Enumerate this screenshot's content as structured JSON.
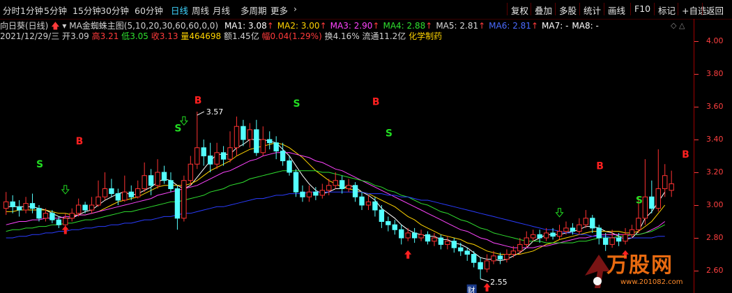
{
  "toolbar": {
    "periods": [
      "分时",
      "1分钟",
      "5分钟",
      "15分钟",
      "30分钟",
      "60分钟",
      "日线",
      "周线",
      "月线",
      "多周期",
      "更多"
    ],
    "active_period": "日线",
    "more_arrow": "›",
    "tools": [
      "复权",
      "叠加",
      "多股",
      "统计",
      "画线",
      "F10",
      "标记",
      "+自选",
      "返回"
    ]
  },
  "info": {
    "stock_name": "向日葵(日线)",
    "indicator": "MA金蜘蛛主图(5,10,20,30,60,60,0,0)",
    "ma": [
      {
        "label": "MA1: 3.08",
        "color": "#ffffff",
        "arrow": "↑"
      },
      {
        "label": "MA2: 3.00",
        "color": "#ffd400",
        "arrow": "↑"
      },
      {
        "label": "MA3: 2.90",
        "color": "#ff44ff",
        "arrow": "↑"
      },
      {
        "label": "MA4: 2.88",
        "color": "#2fe02f",
        "arrow": "↑"
      },
      {
        "label": "MA5: 2.81",
        "color": "#d8d8d8",
        "arrow": "↑"
      },
      {
        "label": "MA6: 2.81",
        "color": "#4a6bff",
        "arrow": "↑"
      },
      {
        "label": "MA7: -",
        "color": "#ffffff",
        "arrow": ""
      },
      {
        "label": "MA8: -",
        "color": "#ffffff",
        "arrow": ""
      }
    ],
    "date": "2021/12/29/三",
    "open_label": "开",
    "open": "3.09",
    "high_label": "高",
    "high": "3.21",
    "low_label": "低",
    "low": "3.05",
    "close_label": "收",
    "close": "3.13",
    "vol_label": "量",
    "vol": "464698",
    "amount_label": "额",
    "amount": "1.45亿",
    "range_label": "幅",
    "range": "0.04(1.29%)",
    "turnover_label": "换",
    "turnover": "4.16%",
    "float_label": "流通",
    "float": "11.2亿",
    "sector": "化学制药"
  },
  "colors": {
    "up": "#ff3232",
    "down": "#54ffff",
    "ma1": "#ffffff",
    "ma2": "#ffd400",
    "ma3": "#ff44ff",
    "ma4": "#2fe02f",
    "ma6": "#2a3cff",
    "axis": "#ff4040"
  },
  "chart_data": {
    "type": "candlestick",
    "ylim": [
      2.53,
      4.16
    ],
    "yticks": [
      "4.00",
      "3.80",
      "3.60",
      "3.40",
      "3.20",
      "3.00",
      "2.80",
      "2.60"
    ],
    "ytick_values": [
      4.0,
      3.8,
      3.6,
      3.4,
      3.2,
      3.0,
      2.8,
      2.6
    ],
    "candles": [
      [
        2.98,
        3.02,
        3.08,
        2.94
      ],
      [
        3.02,
        2.99,
        3.06,
        2.95
      ],
      [
        2.99,
        2.97,
        3.03,
        2.93
      ],
      [
        2.97,
        3.01,
        3.05,
        2.95
      ],
      [
        3.01,
        2.98,
        3.07,
        2.95
      ],
      [
        2.98,
        2.92,
        3.0,
        2.9
      ],
      [
        2.92,
        2.95,
        2.98,
        2.9
      ],
      [
        2.95,
        2.91,
        2.97,
        2.89
      ],
      [
        2.91,
        2.88,
        2.93,
        2.86
      ],
      [
        2.88,
        2.92,
        2.95,
        2.86
      ],
      [
        2.92,
        2.95,
        2.98,
        2.9
      ],
      [
        2.95,
        3.0,
        3.04,
        2.93
      ],
      [
        3.0,
        2.97,
        3.02,
        2.95
      ],
      [
        2.97,
        3.0,
        3.05,
        2.95
      ],
      [
        3.0,
        3.05,
        3.15,
        2.99
      ],
      [
        3.05,
        3.1,
        3.2,
        3.03
      ],
      [
        3.1,
        3.07,
        3.16,
        3.05
      ],
      [
        3.07,
        3.03,
        3.1,
        3.0
      ],
      [
        3.03,
        3.08,
        3.18,
        3.02
      ],
      [
        3.08,
        3.05,
        3.12,
        3.03
      ],
      [
        3.05,
        3.1,
        3.15,
        3.04
      ],
      [
        3.1,
        3.18,
        3.26,
        3.08
      ],
      [
        3.18,
        3.12,
        3.22,
        3.06
      ],
      [
        3.12,
        3.2,
        3.28,
        3.1
      ],
      [
        3.2,
        3.15,
        3.24,
        3.13
      ],
      [
        3.15,
        3.1,
        3.2,
        3.08
      ],
      [
        3.1,
        2.92,
        3.12,
        2.85
      ],
      [
        2.92,
        3.15,
        3.18,
        2.9
      ],
      [
        3.15,
        3.25,
        3.3,
        3.12
      ],
      [
        3.25,
        3.35,
        3.57,
        3.22
      ],
      [
        3.35,
        3.3,
        3.4,
        3.24
      ],
      [
        3.3,
        3.25,
        3.38,
        3.2
      ],
      [
        3.25,
        3.32,
        3.38,
        3.22
      ],
      [
        3.32,
        3.28,
        3.36,
        3.24
      ],
      [
        3.28,
        3.35,
        3.45,
        3.26
      ],
      [
        3.35,
        3.48,
        3.54,
        3.3
      ],
      [
        3.48,
        3.4,
        3.52,
        3.36
      ],
      [
        3.4,
        3.46,
        3.5,
        3.35
      ],
      [
        3.46,
        3.32,
        3.52,
        3.3
      ],
      [
        3.32,
        3.4,
        3.48,
        3.3
      ],
      [
        3.4,
        3.38,
        3.45,
        3.34
      ],
      [
        3.38,
        3.33,
        3.42,
        3.28
      ],
      [
        3.33,
        3.27,
        3.38,
        3.24
      ],
      [
        3.27,
        3.2,
        3.3,
        3.18
      ],
      [
        3.2,
        3.08,
        3.22,
        3.05
      ],
      [
        3.08,
        3.05,
        3.12,
        3.02
      ],
      [
        3.05,
        3.08,
        3.12,
        3.02
      ],
      [
        3.08,
        3.06,
        3.11,
        3.03
      ],
      [
        3.06,
        3.09,
        3.13,
        3.04
      ],
      [
        3.09,
        3.12,
        3.16,
        3.06
      ],
      [
        3.12,
        3.15,
        3.2,
        3.1
      ],
      [
        3.15,
        3.1,
        3.18,
        3.07
      ],
      [
        3.1,
        3.12,
        3.16,
        3.08
      ],
      [
        3.12,
        3.05,
        3.14,
        3.02
      ],
      [
        3.05,
        3.0,
        3.08,
        2.97
      ],
      [
        3.0,
        3.02,
        3.06,
        2.97
      ],
      [
        3.02,
        2.97,
        3.05,
        2.93
      ],
      [
        2.97,
        2.9,
        3.0,
        2.86
      ],
      [
        2.9,
        2.88,
        2.93,
        2.84
      ],
      [
        2.88,
        2.85,
        2.91,
        2.82
      ],
      [
        2.85,
        2.8,
        2.88,
        2.76
      ],
      [
        2.8,
        2.83,
        2.86,
        2.78
      ],
      [
        2.83,
        2.8,
        2.86,
        2.77
      ],
      [
        2.8,
        2.82,
        2.85,
        2.78
      ],
      [
        2.82,
        2.78,
        2.84,
        2.76
      ],
      [
        2.78,
        2.8,
        2.83,
        2.75
      ],
      [
        2.8,
        2.76,
        2.82,
        2.73
      ],
      [
        2.76,
        2.78,
        2.81,
        2.73
      ],
      [
        2.78,
        2.74,
        2.8,
        2.71
      ],
      [
        2.74,
        2.72,
        2.77,
        2.69
      ],
      [
        2.72,
        2.7,
        2.74,
        2.66
      ],
      [
        2.7,
        2.65,
        2.72,
        2.62
      ],
      [
        2.65,
        2.61,
        2.68,
        2.55
      ],
      [
        2.61,
        2.66,
        2.7,
        2.59
      ],
      [
        2.66,
        2.69,
        2.72,
        2.64
      ],
      [
        2.69,
        2.67,
        2.71,
        2.64
      ],
      [
        2.67,
        2.7,
        2.73,
        2.65
      ],
      [
        2.7,
        2.72,
        2.75,
        2.68
      ],
      [
        2.72,
        2.76,
        2.8,
        2.7
      ],
      [
        2.76,
        2.8,
        2.84,
        2.74
      ],
      [
        2.8,
        2.82,
        2.85,
        2.78
      ],
      [
        2.82,
        2.8,
        2.85,
        2.77
      ],
      [
        2.8,
        2.83,
        2.86,
        2.78
      ],
      [
        2.83,
        2.81,
        2.86,
        2.79
      ],
      [
        2.81,
        2.84,
        2.88,
        2.79
      ],
      [
        2.84,
        2.86,
        2.9,
        2.82
      ],
      [
        2.86,
        2.84,
        2.89,
        2.82
      ],
      [
        2.84,
        2.88,
        2.92,
        2.82
      ],
      [
        2.88,
        2.92,
        2.97,
        2.86
      ],
      [
        2.92,
        2.86,
        2.94,
        2.83
      ],
      [
        2.86,
        2.8,
        2.88,
        2.76
      ],
      [
        2.8,
        2.76,
        2.83,
        2.72
      ],
      [
        2.76,
        2.8,
        2.85,
        2.74
      ],
      [
        2.8,
        2.78,
        2.83,
        2.75
      ],
      [
        2.78,
        2.82,
        2.86,
        2.76
      ],
      [
        2.82,
        2.85,
        2.88,
        2.8
      ],
      [
        2.85,
        2.92,
        3.05,
        2.83
      ],
      [
        2.92,
        3.05,
        3.28,
        2.88
      ],
      [
        3.05,
        2.98,
        3.15,
        2.95
      ],
      [
        2.98,
        3.1,
        3.34,
        2.96
      ],
      [
        3.1,
        3.18,
        3.25,
        3.05
      ],
      [
        3.09,
        3.13,
        3.21,
        3.05
      ]
    ],
    "ma_lines": [
      {
        "name": "MA1",
        "color": "#ffffff",
        "values": [
          2.99,
          2.99,
          2.99,
          2.99,
          2.99,
          2.98,
          2.97,
          2.95,
          2.93,
          2.92,
          2.92,
          2.94,
          2.96,
          2.97,
          3.0,
          3.03,
          3.05,
          3.07,
          3.08,
          3.06,
          3.07,
          3.09,
          3.11,
          3.14,
          3.16,
          3.15,
          3.12,
          3.1,
          3.12,
          3.17,
          3.22,
          3.27,
          3.31,
          3.31,
          3.31,
          3.35,
          3.37,
          3.4,
          3.4,
          3.4,
          3.39,
          3.38,
          3.34,
          3.3,
          3.24,
          3.18,
          3.13,
          3.09,
          3.07,
          3.08,
          3.1,
          3.1,
          3.12,
          3.11,
          3.08,
          3.06,
          3.03,
          2.98,
          2.95,
          2.92,
          2.88,
          2.85,
          2.83,
          2.82,
          2.81,
          2.81,
          2.79,
          2.79,
          2.77,
          2.76,
          2.74,
          2.71,
          2.68,
          2.67,
          2.67,
          2.66,
          2.67,
          2.69,
          2.71,
          2.74,
          2.78,
          2.8,
          2.82,
          2.82,
          2.82,
          2.83,
          2.84,
          2.85,
          2.87,
          2.87,
          2.86,
          2.84,
          2.83,
          2.81,
          2.79,
          2.8,
          2.84,
          2.92,
          2.96,
          3.02,
          3.08
        ]
      },
      {
        "name": "MA2",
        "color": "#ffd400",
        "values": [
          2.96,
          2.96,
          2.97,
          2.97,
          2.97,
          2.97,
          2.97,
          2.96,
          2.95,
          2.95,
          2.94,
          2.94,
          2.94,
          2.95,
          2.96,
          2.98,
          3.0,
          3.02,
          3.03,
          3.04,
          3.05,
          3.07,
          3.09,
          3.11,
          3.12,
          3.12,
          3.12,
          3.12,
          3.13,
          3.15,
          3.18,
          3.21,
          3.23,
          3.25,
          3.27,
          3.3,
          3.32,
          3.34,
          3.35,
          3.36,
          3.37,
          3.38,
          3.37,
          3.35,
          3.32,
          3.29,
          3.25,
          3.21,
          3.18,
          3.15,
          3.13,
          3.11,
          3.1,
          3.09,
          3.08,
          3.07,
          3.05,
          3.03,
          3.01,
          2.99,
          2.96,
          2.93,
          2.91,
          2.88,
          2.86,
          2.84,
          2.82,
          2.81,
          2.8,
          2.79,
          2.77,
          2.76,
          2.74,
          2.72,
          2.71,
          2.7,
          2.7,
          2.7,
          2.7,
          2.71,
          2.72,
          2.74,
          2.76,
          2.77,
          2.79,
          2.8,
          2.81,
          2.82,
          2.83,
          2.84,
          2.84,
          2.84,
          2.84,
          2.84,
          2.83,
          2.83,
          2.84,
          2.87,
          2.9,
          2.95,
          3.0
        ]
      },
      {
        "name": "MA3",
        "color": "#ff44ff",
        "values": [
          2.88,
          2.89,
          2.9,
          2.9,
          2.91,
          2.91,
          2.92,
          2.92,
          2.92,
          2.93,
          2.93,
          2.94,
          2.94,
          2.95,
          2.96,
          2.97,
          2.98,
          2.99,
          3.0,
          3.01,
          3.02,
          3.03,
          3.04,
          3.06,
          3.07,
          3.08,
          3.09,
          3.1,
          3.11,
          3.12,
          3.14,
          3.16,
          3.18,
          3.2,
          3.21,
          3.23,
          3.25,
          3.27,
          3.28,
          3.3,
          3.31,
          3.32,
          3.32,
          3.32,
          3.31,
          3.3,
          3.29,
          3.27,
          3.26,
          3.24,
          3.22,
          3.21,
          3.19,
          3.17,
          3.15,
          3.13,
          3.11,
          3.09,
          3.07,
          3.05,
          3.03,
          3.01,
          2.99,
          2.97,
          2.95,
          2.93,
          2.91,
          2.89,
          2.87,
          2.85,
          2.84,
          2.82,
          2.8,
          2.79,
          2.77,
          2.76,
          2.75,
          2.74,
          2.74,
          2.74,
          2.74,
          2.75,
          2.75,
          2.76,
          2.77,
          2.78,
          2.79,
          2.8,
          2.8,
          2.81,
          2.82,
          2.82,
          2.82,
          2.82,
          2.82,
          2.82,
          2.82,
          2.83,
          2.85,
          2.87,
          2.9
        ]
      },
      {
        "name": "MA4",
        "color": "#2fe02f",
        "values": [
          2.84,
          2.85,
          2.85,
          2.86,
          2.86,
          2.87,
          2.87,
          2.88,
          2.88,
          2.89,
          2.89,
          2.9,
          2.91,
          2.91,
          2.92,
          2.93,
          2.94,
          2.95,
          2.96,
          2.96,
          2.97,
          2.98,
          2.99,
          3.0,
          3.01,
          3.02,
          3.02,
          3.03,
          3.04,
          3.05,
          3.06,
          3.08,
          3.09,
          3.1,
          3.12,
          3.13,
          3.14,
          3.16,
          3.17,
          3.18,
          3.19,
          3.2,
          3.21,
          3.21,
          3.21,
          3.21,
          3.21,
          3.21,
          3.2,
          3.2,
          3.19,
          3.18,
          3.17,
          3.16,
          3.15,
          3.14,
          3.12,
          3.11,
          3.09,
          3.08,
          3.06,
          3.05,
          3.03,
          3.01,
          3.0,
          2.98,
          2.96,
          2.95,
          2.93,
          2.91,
          2.9,
          2.88,
          2.86,
          2.85,
          2.83,
          2.82,
          2.81,
          2.8,
          2.79,
          2.78,
          2.78,
          2.78,
          2.77,
          2.77,
          2.77,
          2.77,
          2.77,
          2.78,
          2.78,
          2.79,
          2.8,
          2.8,
          2.8,
          2.81,
          2.81,
          2.82,
          2.82,
          2.83,
          2.84,
          2.86,
          2.88
        ]
      },
      {
        "name": "MA6",
        "color": "#2a3cff",
        "values": [
          2.8,
          2.8,
          2.81,
          2.81,
          2.82,
          2.82,
          2.83,
          2.83,
          2.84,
          2.84,
          2.85,
          2.85,
          2.86,
          2.86,
          2.87,
          2.87,
          2.88,
          2.88,
          2.89,
          2.89,
          2.9,
          2.91,
          2.91,
          2.92,
          2.93,
          2.93,
          2.94,
          2.95,
          2.95,
          2.96,
          2.97,
          2.98,
          2.99,
          2.99,
          3.0,
          3.01,
          3.02,
          3.03,
          3.04,
          3.04,
          3.05,
          3.06,
          3.06,
          3.07,
          3.07,
          3.07,
          3.08,
          3.08,
          3.08,
          3.08,
          3.08,
          3.08,
          3.08,
          3.08,
          3.08,
          3.07,
          3.07,
          3.07,
          3.06,
          3.06,
          3.05,
          3.05,
          3.04,
          3.03,
          3.03,
          3.02,
          3.01,
          3.0,
          2.99,
          2.98,
          2.97,
          2.96,
          2.95,
          2.94,
          2.93,
          2.92,
          2.91,
          2.9,
          2.89,
          2.88,
          2.87,
          2.86,
          2.85,
          2.85,
          2.84,
          2.83,
          2.83,
          2.82,
          2.82,
          2.81,
          2.81,
          2.81,
          2.8,
          2.8,
          2.8,
          2.8,
          2.8,
          2.8,
          2.8,
          2.81,
          2.81
        ]
      }
    ],
    "signals": [
      {
        "text": "S",
        "color": "#22dd22",
        "index": 5,
        "price": 3.23
      },
      {
        "text": "B",
        "color": "#ff2020",
        "index": 11,
        "price": 3.37
      },
      {
        "text": "S",
        "color": "#22dd22",
        "index": 26,
        "price": 3.45
      },
      {
        "text": "B",
        "color": "#ff2020",
        "index": 29,
        "price": 3.62
      },
      {
        "text": "S",
        "color": "#22dd22",
        "index": 44,
        "price": 3.6
      },
      {
        "text": "B",
        "color": "#ff2020",
        "index": 56,
        "price": 3.61
      },
      {
        "text": "S",
        "color": "#22dd22",
        "index": 58,
        "price": 3.42
      },
      {
        "text": "B",
        "color": "#ff2020",
        "index": 90,
        "price": 3.22
      },
      {
        "text": "S",
        "color": "#22dd22",
        "index": 96,
        "price": 3.01
      },
      {
        "text": "B",
        "color": "#ff2020",
        "index": 103,
        "price": 3.29
      }
    ],
    "annotations": [
      {
        "text": "3.57",
        "index": 29,
        "price": 3.57
      },
      {
        "text": "2.55",
        "index": 72,
        "price": 2.55
      },
      {
        "text": "财",
        "index": 71,
        "price": 2.55
      }
    ]
  },
  "watermark": {
    "brand": "万股网",
    "url": "www.201082.com"
  }
}
